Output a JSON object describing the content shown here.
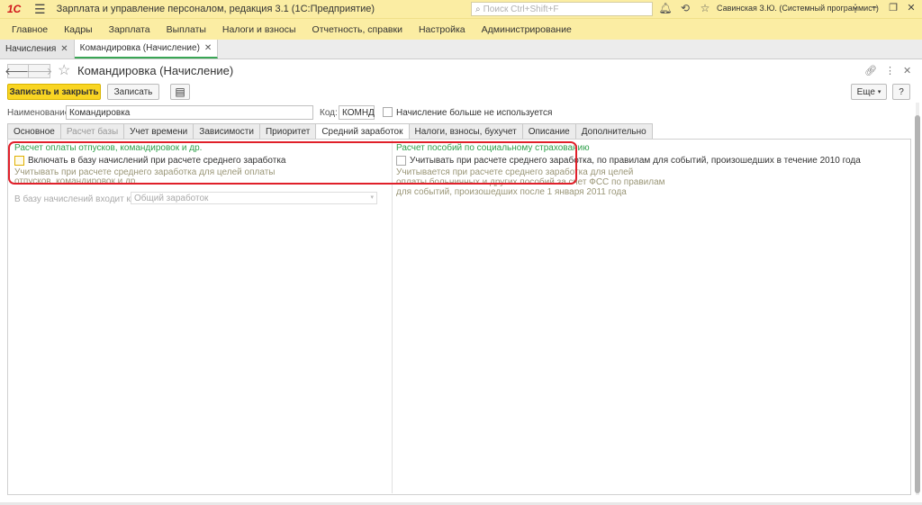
{
  "titlebar": {
    "logo": "1С",
    "app_title": "Зарплата и управление персоналом, редакция 3.1  (1С:Предприятие)",
    "search_placeholder": "Поиск Ctrl+Shift+F",
    "user": "Савинская З.Ю. (Системный программист)"
  },
  "menu": [
    "Главное",
    "Кадры",
    "Зарплата",
    "Выплаты",
    "Налоги и взносы",
    "Отчетность, справки",
    "Настройка",
    "Администрирование"
  ],
  "open_tabs": [
    {
      "label": "Начисления",
      "active": false
    },
    {
      "label": "Командировка (Начисление)",
      "active": true
    }
  ],
  "form": {
    "title": "Командировка (Начисление)",
    "btn_save_close": "Записать и закрыть",
    "btn_save": "Записать",
    "btn_more": "Еще",
    "btn_help": "?",
    "name_label": "Наименование:",
    "name_value": "Командировка",
    "code_label": "Код:",
    "code_value": "КОМНД",
    "unused_label": "Начисление больше не используется"
  },
  "tabs": [
    {
      "label": "Основное",
      "state": "normal"
    },
    {
      "label": "Расчет базы",
      "state": "disabled"
    },
    {
      "label": "Учет времени",
      "state": "normal"
    },
    {
      "label": "Зависимости",
      "state": "normal"
    },
    {
      "label": "Приоритет",
      "state": "normal"
    },
    {
      "label": "Средний заработок",
      "state": "active"
    },
    {
      "label": "Налоги, взносы, бухучет",
      "state": "normal"
    },
    {
      "label": "Описание",
      "state": "normal"
    },
    {
      "label": "Дополнительно",
      "state": "normal"
    }
  ],
  "left_group": {
    "title": "Расчет оплаты отпусков, командировок и др.",
    "checkbox_label": "Включать в базу начислений при расчете среднего заработка",
    "hint_line1": "Учитывать при расчете среднего заработка для целей оплаты",
    "hint_line2": "отпусков, командировок и др.",
    "base_label": "В базу начислений входит как:",
    "base_value": "Общий заработок"
  },
  "right_group": {
    "title": "Расчет пособий по социальному страхованию",
    "checkbox_label": "Учитывать при расчете среднего заработка, по правилам для событий, произошедших в течение 2010 года",
    "hint_line1": "Учитывается при расчете среднего заработка для целей",
    "hint_line2": "оплаты больничных и других пособий за счет ФСС по правилам",
    "hint_line3": "для событий, произошедших после 1 января 2011 года"
  },
  "colors": {
    "titlebar": "#fbeda3",
    "primary_button": "#f9d523",
    "group_title": "#2fa04b",
    "highlight": "#e0202a"
  }
}
